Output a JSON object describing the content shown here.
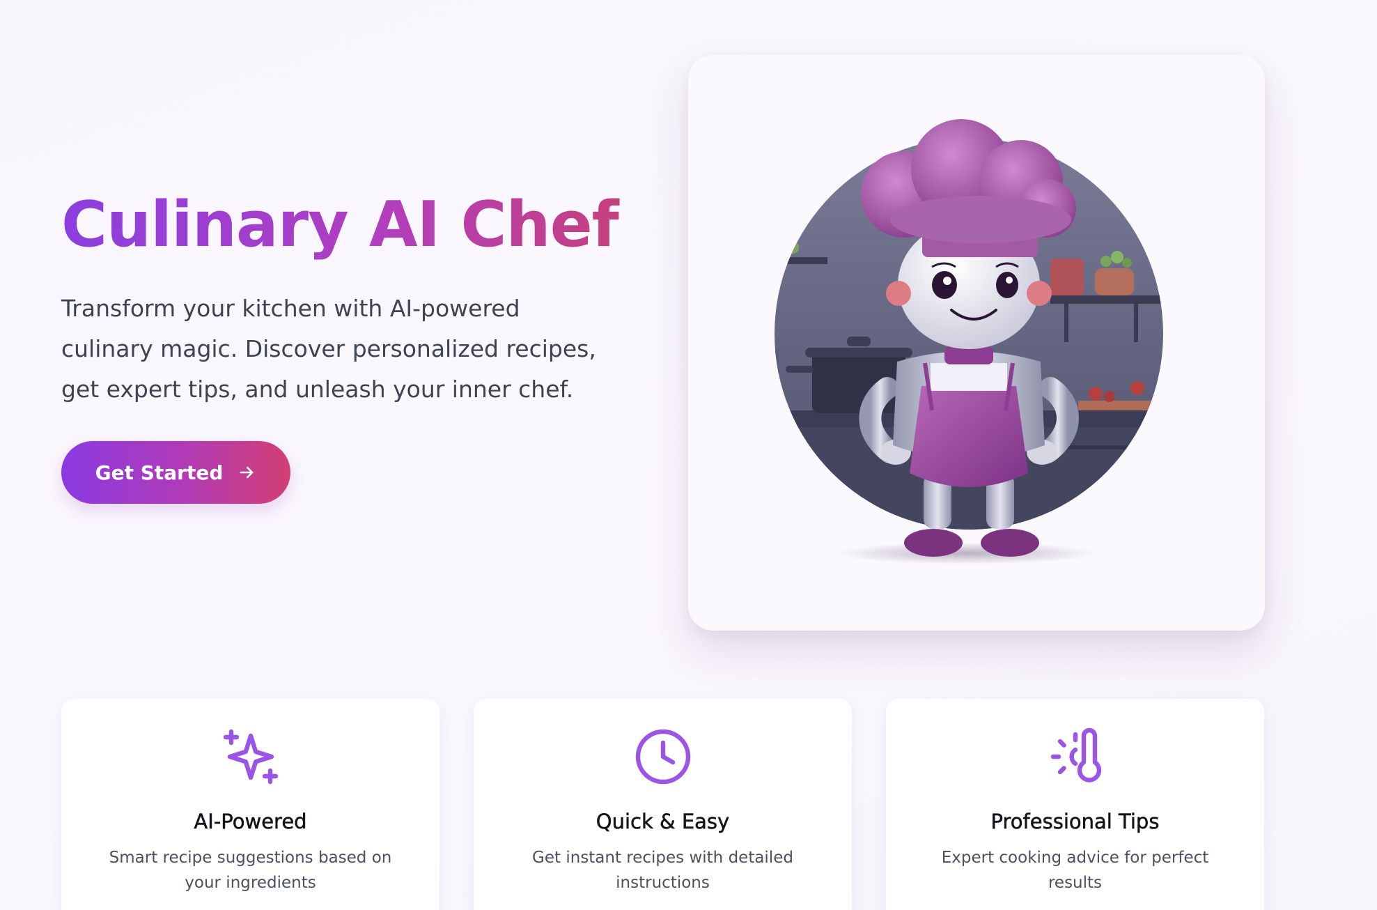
{
  "hero": {
    "title": "Culinary AI Chef",
    "subtitle": "Transform your kitchen with AI-powered culinary magic. Discover personalized recipes, get expert tips, and unleash your inner chef.",
    "cta_label": "Get Started",
    "image_subject": "robot chef mascot with purple toque and apron in a kitchen"
  },
  "features": [
    {
      "icon": "sparkles-icon",
      "title": "AI-Powered",
      "description": "Smart recipe suggestions based on your ingredients"
    },
    {
      "icon": "clock-icon",
      "title": "Quick & Easy",
      "description": "Get instant recipes with detailed instructions"
    },
    {
      "icon": "thermometer-sun-icon",
      "title": "Professional Tips",
      "description": "Expert cooking advice for perfect results"
    }
  ],
  "colors": {
    "accent_purple": "#8b3fdf",
    "accent_pink": "#d23f72",
    "icon_purple": "#9a55e6",
    "background": "#f9f6fd"
  }
}
